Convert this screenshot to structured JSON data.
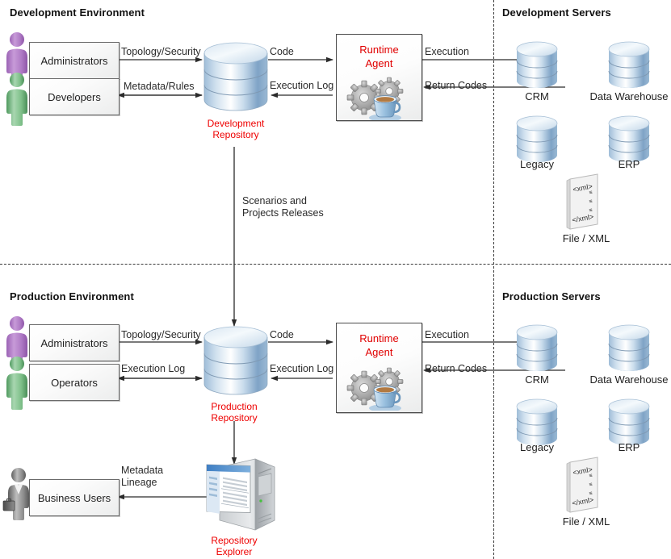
{
  "sections": {
    "dev_env": "Development Environment",
    "dev_servers": "Development Servers",
    "prod_env": "Production Environment",
    "prod_servers": "Production Servers"
  },
  "colors": {
    "red_label": "#ee0000",
    "admin_person": "#b07cc6",
    "dev_person": "#7fc08a",
    "business_person": "#808080",
    "cylinder_blue": "#8fb4d9",
    "divider": "#3a3a3a"
  },
  "dev": {
    "actors": [
      {
        "label": "Administrators",
        "person": "admin-person-icon"
      },
      {
        "label": "Developers",
        "person": "developer-person-icon"
      }
    ],
    "repository": {
      "line1": "Development",
      "line2": "Repository"
    },
    "agent": {
      "line1": "Runtime",
      "line2": "Agent"
    },
    "flows": {
      "topology": "Topology/Security",
      "metadata": "Metadata/Rules",
      "code": "Code",
      "execution_log": "Execution Log",
      "execution": "Execution",
      "return_codes": "Return Codes"
    }
  },
  "transfer": {
    "line1": "Scenarios and",
    "line2": "Projects Releases"
  },
  "prod": {
    "actors": [
      {
        "label": "Administrators",
        "person": "admin-person-icon"
      },
      {
        "label": "Operators",
        "person": "operator-person-icon"
      }
    ],
    "repository": {
      "line1": "Production",
      "line2": "Repository"
    },
    "agent": {
      "line1": "Runtime",
      "line2": "Agent"
    },
    "flows": {
      "topology": "Topology/Security",
      "execution_log_left": "Execution Log",
      "code": "Code",
      "execution_log_right": "Execution Log",
      "execution": "Execution",
      "return_codes": "Return Codes"
    },
    "explorer": {
      "line1": "Repository",
      "line2": "Explorer"
    },
    "business": {
      "label": "Business Users"
    },
    "lineage": {
      "line1": "Metadata",
      "line2": "Lineage"
    }
  },
  "servers": {
    "dev": [
      {
        "label": "CRM",
        "icon": "database-cylinder-icon"
      },
      {
        "label": "Data Warehouse",
        "icon": "database-cylinder-icon"
      },
      {
        "label": "Legacy",
        "icon": "database-cylinder-icon"
      },
      {
        "label": "ERP",
        "icon": "database-cylinder-icon"
      },
      {
        "label": "File /  XML",
        "icon": "xml-file-icon"
      }
    ],
    "prod": [
      {
        "label": "CRM",
        "icon": "database-cylinder-icon"
      },
      {
        "label": "Data Warehouse",
        "icon": "database-cylinder-icon"
      },
      {
        "label": "Legacy",
        "icon": "database-cylinder-icon"
      },
      {
        "label": "ERP",
        "icon": "database-cylinder-icon"
      },
      {
        "label": "File /  XML",
        "icon": "xml-file-icon"
      }
    ]
  },
  "xml_icon_text": {
    "open": "<xml>",
    "close": "</xml>"
  }
}
